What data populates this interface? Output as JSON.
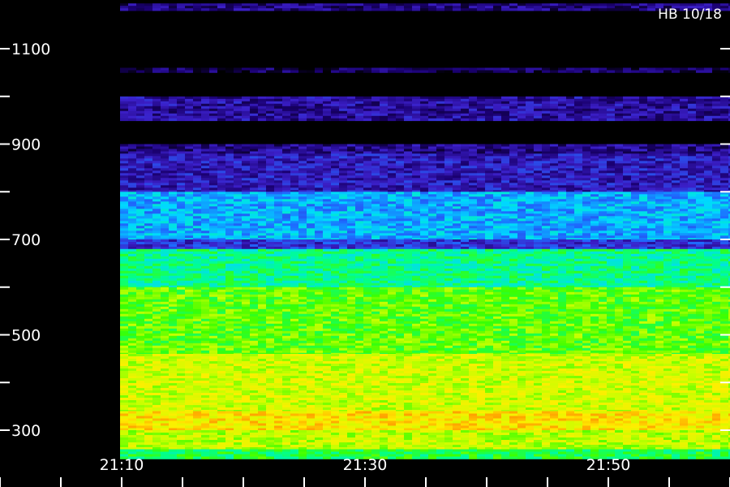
{
  "chart_data": {
    "type": "heatmap",
    "title": "HB 10/18",
    "xlabel": "",
    "ylabel": "",
    "y_ticks": [
      1100,
      900,
      700,
      500,
      300
    ],
    "y_minor_ticks": [
      1000,
      800,
      600,
      400
    ],
    "x_ticks": [
      "21:10",
      "21:30",
      "21:50"
    ],
    "xlim": [
      "21:10",
      "21:57"
    ],
    "ylim": [
      200,
      1200
    ],
    "colormap": [
      "#000000",
      "#1a0070",
      "#3b1fc8",
      "#1d6cff",
      "#00d8ff",
      "#00ff90",
      "#3cff00",
      "#c8ff00",
      "#ffee00",
      "#ff8c00",
      "#ff2000"
    ],
    "intensity_bands": [
      {
        "y_range": [
          1180,
          1195
        ],
        "level": 0.12
      },
      {
        "y_range": [
          1050,
          1060
        ],
        "level": 0.08
      },
      {
        "y_range": [
          950,
          1000
        ],
        "level": 0.15
      },
      {
        "y_range": [
          880,
          900
        ],
        "level": 0.13
      },
      {
        "y_range": [
          800,
          880
        ],
        "level": 0.18
      },
      {
        "y_range": [
          700,
          800
        ],
        "level": 0.36
      },
      {
        "y_range": [
          680,
          700
        ],
        "level": 0.22
      },
      {
        "y_range": [
          600,
          680
        ],
        "level": 0.5
      },
      {
        "y_range": [
          460,
          600
        ],
        "level": 0.62
      },
      {
        "y_range": [
          340,
          460
        ],
        "level": 0.72
      },
      {
        "y_range": [
          300,
          340
        ],
        "level": 0.8
      },
      {
        "y_range": [
          260,
          300
        ],
        "level": 0.7
      },
      {
        "y_range": [
          240,
          260
        ],
        "level": 0.55
      }
    ]
  }
}
